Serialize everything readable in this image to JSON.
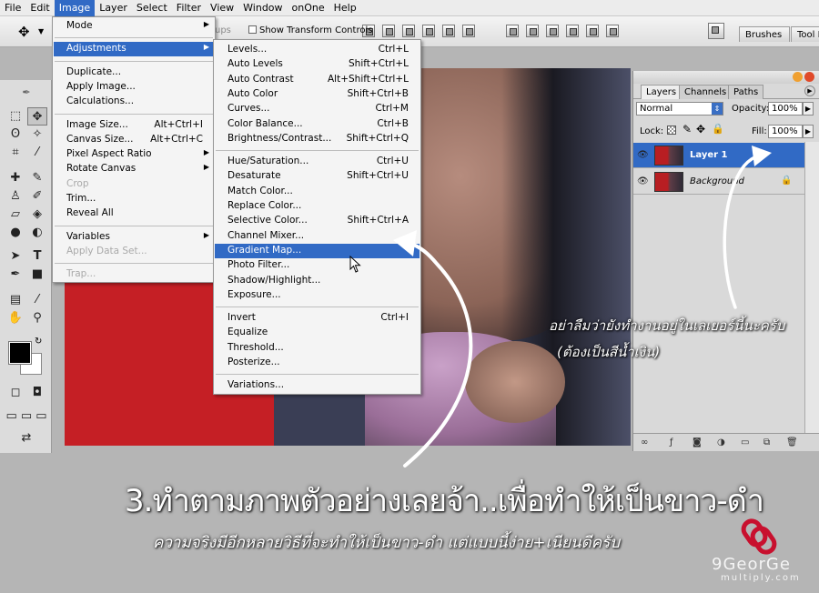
{
  "menubar": [
    "File",
    "Edit",
    "Image",
    "Layer",
    "Select",
    "Filter",
    "View",
    "Window",
    "onOne",
    "Help"
  ],
  "options_bar": {
    "groups_text": "ups",
    "show_transform": "Show Transform Controls"
  },
  "panel_tabs": [
    "Brushes",
    "Tool P"
  ],
  "image_menu": [
    {
      "label": "Mode",
      "sub": true
    },
    {
      "sep": true
    },
    {
      "label": "Adjustments",
      "sub": true,
      "hl": true
    },
    {
      "sep": true
    },
    {
      "label": "Duplicate..."
    },
    {
      "label": "Apply Image..."
    },
    {
      "label": "Calculations..."
    },
    {
      "sep": true
    },
    {
      "label": "Image Size...",
      "sc": "Alt+Ctrl+I"
    },
    {
      "label": "Canvas Size...",
      "sc": "Alt+Ctrl+C"
    },
    {
      "label": "Pixel Aspect Ratio",
      "sub": true
    },
    {
      "label": "Rotate Canvas",
      "sub": true
    },
    {
      "label": "Crop",
      "dis": true
    },
    {
      "label": "Trim..."
    },
    {
      "label": "Reveal All"
    },
    {
      "sep": true
    },
    {
      "label": "Variables",
      "sub": true
    },
    {
      "label": "Apply Data Set...",
      "dis": true
    },
    {
      "sep": true
    },
    {
      "label": "Trap...",
      "dis": true
    }
  ],
  "adjust_menu": [
    {
      "label": "Levels...",
      "sc": "Ctrl+L"
    },
    {
      "label": "Auto Levels",
      "sc": "Shift+Ctrl+L"
    },
    {
      "label": "Auto Contrast",
      "sc": "Alt+Shift+Ctrl+L"
    },
    {
      "label": "Auto Color",
      "sc": "Shift+Ctrl+B"
    },
    {
      "label": "Curves...",
      "sc": "Ctrl+M"
    },
    {
      "label": "Color Balance...",
      "sc": "Ctrl+B"
    },
    {
      "label": "Brightness/Contrast...",
      "sc": "Shift+Ctrl+Q"
    },
    {
      "sep": true
    },
    {
      "label": "Hue/Saturation...",
      "sc": "Ctrl+U"
    },
    {
      "label": "Desaturate",
      "sc": "Shift+Ctrl+U"
    },
    {
      "label": "Match Color..."
    },
    {
      "label": "Replace Color..."
    },
    {
      "label": "Selective Color...",
      "sc": "Shift+Ctrl+A"
    },
    {
      "label": "Channel Mixer..."
    },
    {
      "label": "Gradient Map...",
      "hl": true
    },
    {
      "label": "Photo Filter..."
    },
    {
      "label": "Shadow/Highlight..."
    },
    {
      "label": "Exposure..."
    },
    {
      "sep": true
    },
    {
      "label": "Invert",
      "sc": "Ctrl+I"
    },
    {
      "label": "Equalize"
    },
    {
      "label": "Threshold..."
    },
    {
      "label": "Posterize..."
    },
    {
      "sep": true
    },
    {
      "label": "Variations..."
    }
  ],
  "layers_panel": {
    "tabs": [
      "Layers",
      "Channels",
      "Paths"
    ],
    "blend_mode": "Normal",
    "opacity_label": "Opacity:",
    "opacity": "100%",
    "lock_label": "Lock:",
    "fill_label": "Fill:",
    "fill": "100%",
    "layers": [
      {
        "name": "Layer 1",
        "selected": true
      },
      {
        "name": "Background",
        "selected": false
      }
    ]
  },
  "annotations": {
    "title": "3.ทำตามภาพตัวอย่างเลยจ้า..เพื่อทำให้เป็นขาว-ดำ",
    "subtitle": "ความจริงมีอีกหลายวิธีที่จะทำให้เป็นขาว-ดำ แต่แบบนี้ง่าย+เนียนดีครับ",
    "side_note_1": "อย่าลืมว่ายังทำงานอยู่ในเลเยอร์นี้นะครับ",
    "side_note_2": "(ต้องเป็นสีน้ำเงิน)"
  },
  "watermark": {
    "name": "9GeorGe",
    "site": "multiply.com"
  },
  "colors": {
    "highlight": "#316ac5",
    "watermark_logo": "#c8102e"
  }
}
